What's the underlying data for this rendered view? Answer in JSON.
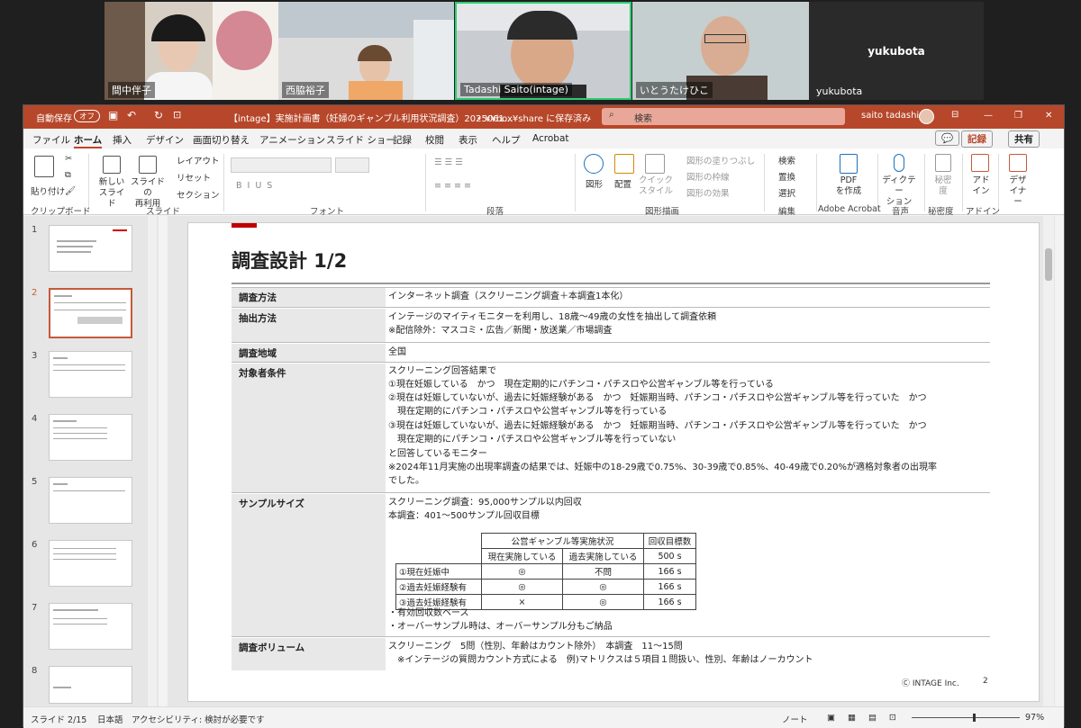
{
  "video": {
    "p1": "間中伴子",
    "p2": "西脇裕子",
    "p3": "Tadashi Saito(intage)",
    "p4": "いとうたけひこ",
    "p5_big": "yukubota",
    "p5": "yukubota"
  },
  "titlebar": {
    "autosave": "自動保存",
    "autosave_toggle": "オフ",
    "doc_title": "【intage】実施計画書（妊婦のギャンブル利用状況調査）2025061…",
    "save_status": "• ¥¥box¥share に保存済み",
    "search_placeholder": "検索",
    "user": "saito tadashi",
    "minimize": "—",
    "restore": "❐",
    "close": "✕"
  },
  "menu": [
    "ファイル",
    "ホーム",
    "挿入",
    "デザイン",
    "画面切り替え",
    "アニメーション",
    "スライド ショー",
    "記録",
    "校閲",
    "表示",
    "ヘルプ",
    "Acrobat"
  ],
  "menu_right": {
    "comment": "💬",
    "record": "記録",
    "share": "共有"
  },
  "ribbon": {
    "paste": "貼り付け",
    "new_slide": "新しい\nスライド",
    "reuse": "スライドの\n再利用",
    "layout": "レイアウト",
    "reset": "リセット",
    "section": "セクション",
    "shape": "図形",
    "arrange": "配置",
    "quick_style": "クイック\nスタイル",
    "fill": "図形の塗りつぶし",
    "outline": "図形の枠線",
    "effect": "図形の効果",
    "find": "検索",
    "replace": "置換",
    "select": "選択",
    "pdf": "PDF\nを作成",
    "dictate": "ディクテー\nション",
    "sensitivity": "秘密\n度",
    "addin": "アド\nイン",
    "designer": "デザ\nイナー",
    "groups": [
      "クリップボード",
      "スライド",
      "フォント",
      "段落",
      "図形描画",
      "編集",
      "Adobe Acrobat",
      "音声",
      "秘密度",
      "アドイン"
    ]
  },
  "thumbs": [
    "1",
    "2",
    "3",
    "4",
    "5",
    "6",
    "7",
    "8"
  ],
  "slide": {
    "title": "調査設計 1/2",
    "rows": [
      {
        "label": "調査方法",
        "lines": [
          "インターネット調査（スクリーニング調査＋本調査1本化）"
        ]
      },
      {
        "label": "抽出方法",
        "lines": [
          "インテージのマイティモニターを利用し、18歳～49歳の女性を抽出して調査依頼",
          "※配信除外：マスコミ・広告／新聞・放送業／市場調査"
        ]
      },
      {
        "label": "調査地域",
        "lines": [
          "全国"
        ]
      },
      {
        "label": "対象者条件",
        "lines": [
          "スクリーニング回答結果で",
          "①現在妊娠している　かつ　現在定期的にパチンコ・パチスロや公営ギャンブル等を行っている",
          "②現在は妊娠していないが、過去に妊娠経験がある　かつ　妊娠期当時、パチンコ・パチスロや公営ギャンブル等を行っていた　かつ",
          "　現在定期的にパチンコ・パチスロや公営ギャンブル等を行っている",
          "③現在は妊娠していないが、過去に妊娠経験がある　かつ　妊娠期当時、パチンコ・パチスロや公営ギャンブル等を行っていた　かつ",
          "　現在定期的にパチンコ・パチスロや公営ギャンブル等を行っていない",
          "と回答しているモニター",
          "※2024年11月実施の出現率調査の結果では、妊娠中の18-29歳で0.75%、30-39歳で0.85%、40-49歳で0.20%が適格対象者の出現率",
          "でした。"
        ]
      },
      {
        "label": "サンプルサイズ",
        "lines": [
          "スクリーニング調査：95,000サンプル以内回収",
          "本調査：401～500サンプル回収目標"
        ]
      },
      {
        "label": "調査ボリューム",
        "lines": [
          "スクリーニング　5問（性別、年齢はカウント除外）　本調査　11～15問",
          "　※インテージの質問カウント方式による　例)マトリクスは５項目１問扱い、性別、年齢はノーカウント"
        ]
      }
    ],
    "notes": [
      "・有効回収数ベース",
      "・オーバーサンプル時は、オーバーサンプル分もご納品"
    ],
    "table": {
      "h_group": "公営ギャンブル等実施状況",
      "h_target": "回収目標数",
      "h_now": "現在実施している",
      "h_past": "過去実施している",
      "h_total": "500 s",
      "rows": [
        {
          "label": "①現在妊娠中",
          "now": "◎",
          "past": "不問",
          "n": "166 s"
        },
        {
          "label": "②過去妊娠経験有",
          "now": "◎",
          "past": "◎",
          "n": "166 s"
        },
        {
          "label": "③過去妊娠経験有",
          "now": "×",
          "past": "◎",
          "n": "166 s"
        }
      ]
    },
    "footer": "Ⓒ INTAGE Inc.",
    "page": "2"
  },
  "status": {
    "slide": "スライド 2/15",
    "lang": "日本語",
    "access": "アクセシビリティ: 検討が必要です",
    "notes": "ノート",
    "zoom": "97%"
  }
}
